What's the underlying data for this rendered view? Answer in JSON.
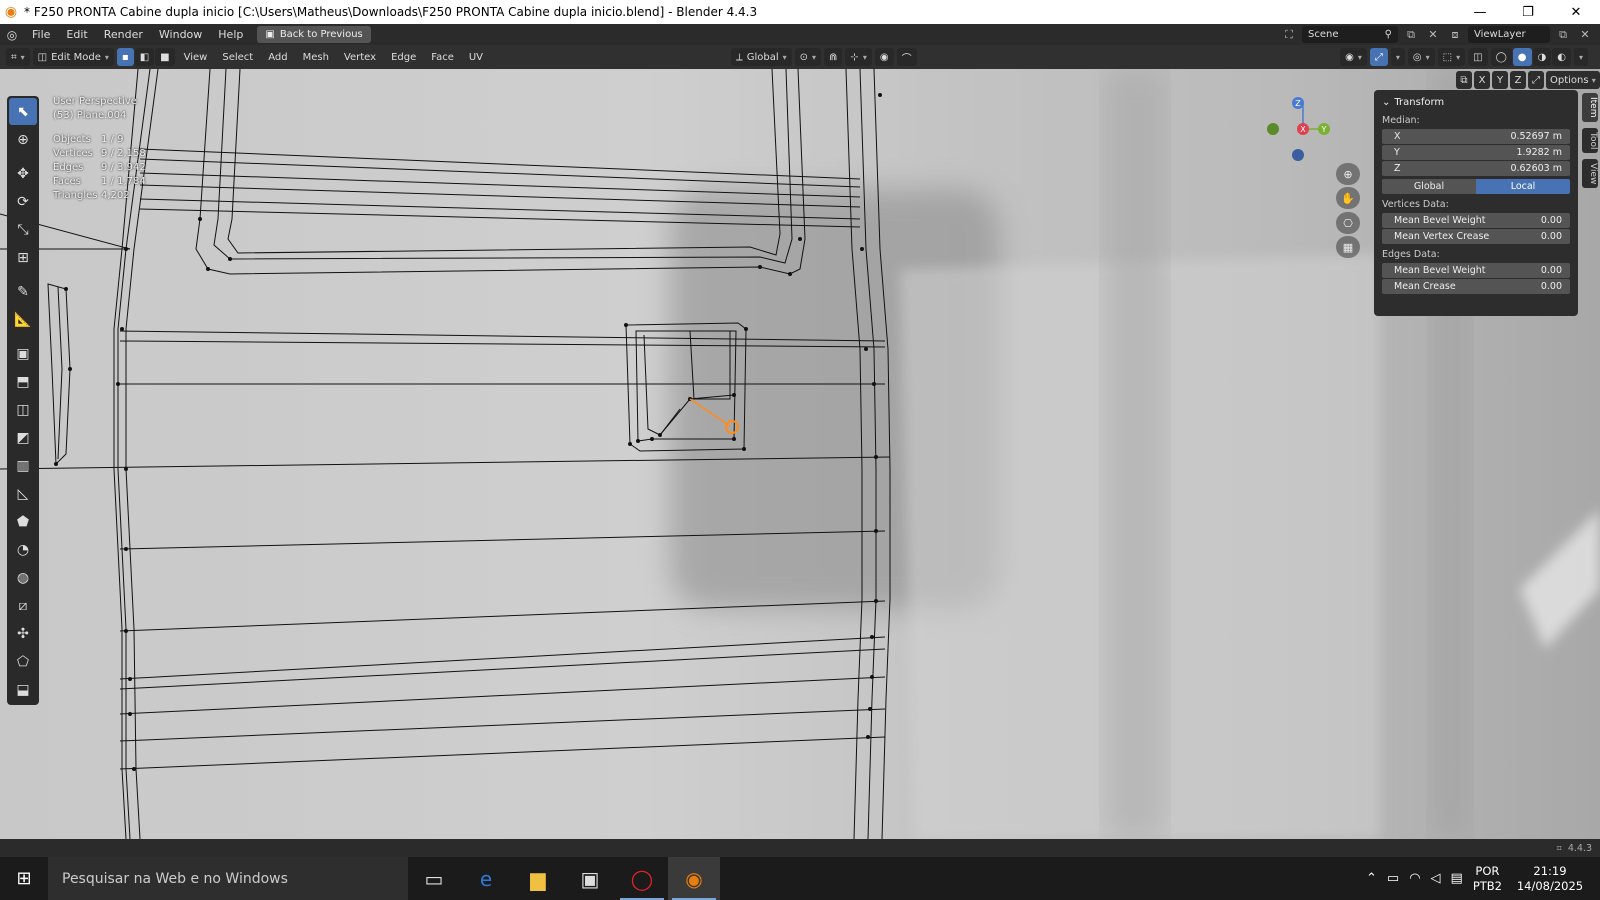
{
  "window": {
    "title": "* F250 PRONTA Cabine dupla inicio [C:\\Users\\Matheus\\Downloads\\F250 PRONTA Cabine dupla inicio.blend] - Blender 4.4.3",
    "minimize": "—",
    "restore": "❐",
    "close": "✕"
  },
  "menubar": {
    "items": [
      "File",
      "Edit",
      "Render",
      "Window",
      "Help"
    ],
    "back_label": "Back to Previous",
    "scene": "Scene",
    "view_layer": "ViewLayer"
  },
  "header": {
    "mode": "Edit Mode",
    "menus": [
      "View",
      "Select",
      "Add",
      "Mesh",
      "Vertex",
      "Edge",
      "Face",
      "UV"
    ],
    "orientation": "Global"
  },
  "viewport": {
    "perspective": "User Perspective",
    "object": "(53) Plane.004",
    "stats": [
      {
        "label": "Objects",
        "value": "1 / 9"
      },
      {
        "label": "Vertices",
        "value": "9 / 2,158"
      },
      {
        "label": "Edges",
        "value": "9 / 3,942"
      },
      {
        "label": "Faces",
        "value": "1 / 1,784"
      },
      {
        "label": "Triangles",
        "value": "4,202"
      }
    ],
    "options_label": "Options",
    "axes": {
      "x": "X",
      "y": "Y",
      "z": "Z"
    }
  },
  "npanel": {
    "title": "Transform",
    "median_label": "Median:",
    "x_label": "X",
    "x": "0.52697 m",
    "y_label": "Y",
    "y": "1.9282 m",
    "z_label": "Z",
    "z": "0.62603 m",
    "global": "Global",
    "local": "Local",
    "vertices_data": "Vertices Data:",
    "mean_bevel_weight_label": "Mean Bevel Weight",
    "mean_bevel_weight_v": "0.00",
    "mean_vertex_crease_label": "Mean Vertex Crease",
    "mean_vertex_crease": "0.00",
    "edges_data": "Edges Data:",
    "edge_bevel_weight_label": "Mean Bevel Weight",
    "edge_bevel_weight": "0.00",
    "mean_crease_label": "Mean Crease",
    "mean_crease": "0.00",
    "tabs": [
      "Item",
      "Tool",
      "View"
    ]
  },
  "statusbar": {
    "version": "4.4.3"
  },
  "taskbar": {
    "search_placeholder": "Pesquisar na Web e no Windows",
    "lang_top": "POR",
    "lang_bottom": "PTB2",
    "time": "21:19",
    "date": "14/08/2025"
  },
  "colors": {
    "accent": "#4772b3",
    "selection": "#ff8c1a"
  }
}
